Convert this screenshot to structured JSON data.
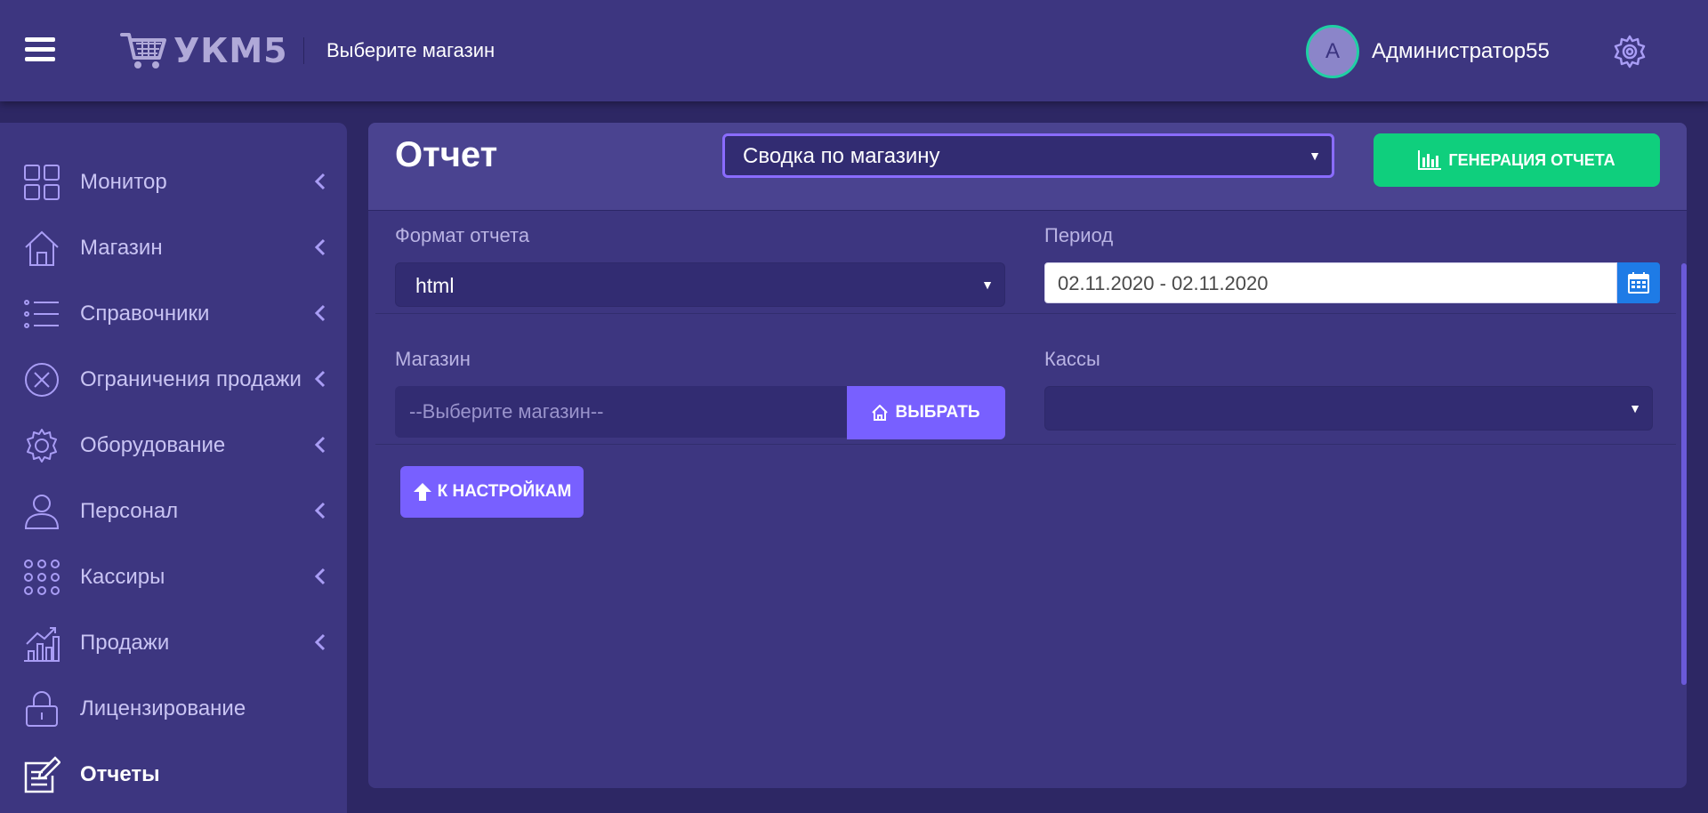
{
  "header": {
    "logo_text": "УКМ5",
    "store_picker": "Выберите магазин",
    "user": {
      "avatar_letter": "A",
      "name": "Администратор55"
    },
    "icons": [
      "menu-icon",
      "cart-icon",
      "gear-icon"
    ]
  },
  "sidebar": {
    "items": [
      {
        "label": "Монитор",
        "icon": "dashboard-icon",
        "has_submenu": true
      },
      {
        "label": "Магазин",
        "icon": "home-icon",
        "has_submenu": true
      },
      {
        "label": "Справочники",
        "icon": "list-icon",
        "has_submenu": true
      },
      {
        "label": "Ограничения продажи",
        "icon": "circle-x-icon",
        "has_submenu": true
      },
      {
        "label": "Оборудование",
        "icon": "gear-icon",
        "has_submenu": true
      },
      {
        "label": "Персонал",
        "icon": "person-icon",
        "has_submenu": true
      },
      {
        "label": "Кассиры",
        "icon": "dots-grid-icon",
        "has_submenu": true
      },
      {
        "label": "Продажи",
        "icon": "sales-chart-icon",
        "has_submenu": true
      },
      {
        "label": "Лицензирование",
        "icon": "lock-icon",
        "has_submenu": false
      },
      {
        "label": "Отчеты",
        "icon": "report-edit-icon",
        "has_submenu": false,
        "active": true
      }
    ]
  },
  "report": {
    "title": "Отчет",
    "report_type": "Сводка по магазину",
    "generate_button": "ГЕНЕРАЦИЯ ОТЧЕТА",
    "format_label": "Формат отчета",
    "format_value": "html",
    "period_label": "Период",
    "period_value": "02.11.2020 - 02.11.2020",
    "store_label": "Магазин",
    "store_placeholder": "--Выберите магазин--",
    "pick_button": "ВЫБРАТЬ",
    "cash_label": "Кассы",
    "cash_value": "",
    "back_button": "К НАСТРОЙКАМ"
  },
  "colors": {
    "header_bg": "#3d3680",
    "page_bg": "#2d2764",
    "accent_purple": "#7860ff",
    "accent_green": "#0fcf7d",
    "calendar_blue": "#1e7be6",
    "avatar_ring": "#1fd0a4"
  }
}
